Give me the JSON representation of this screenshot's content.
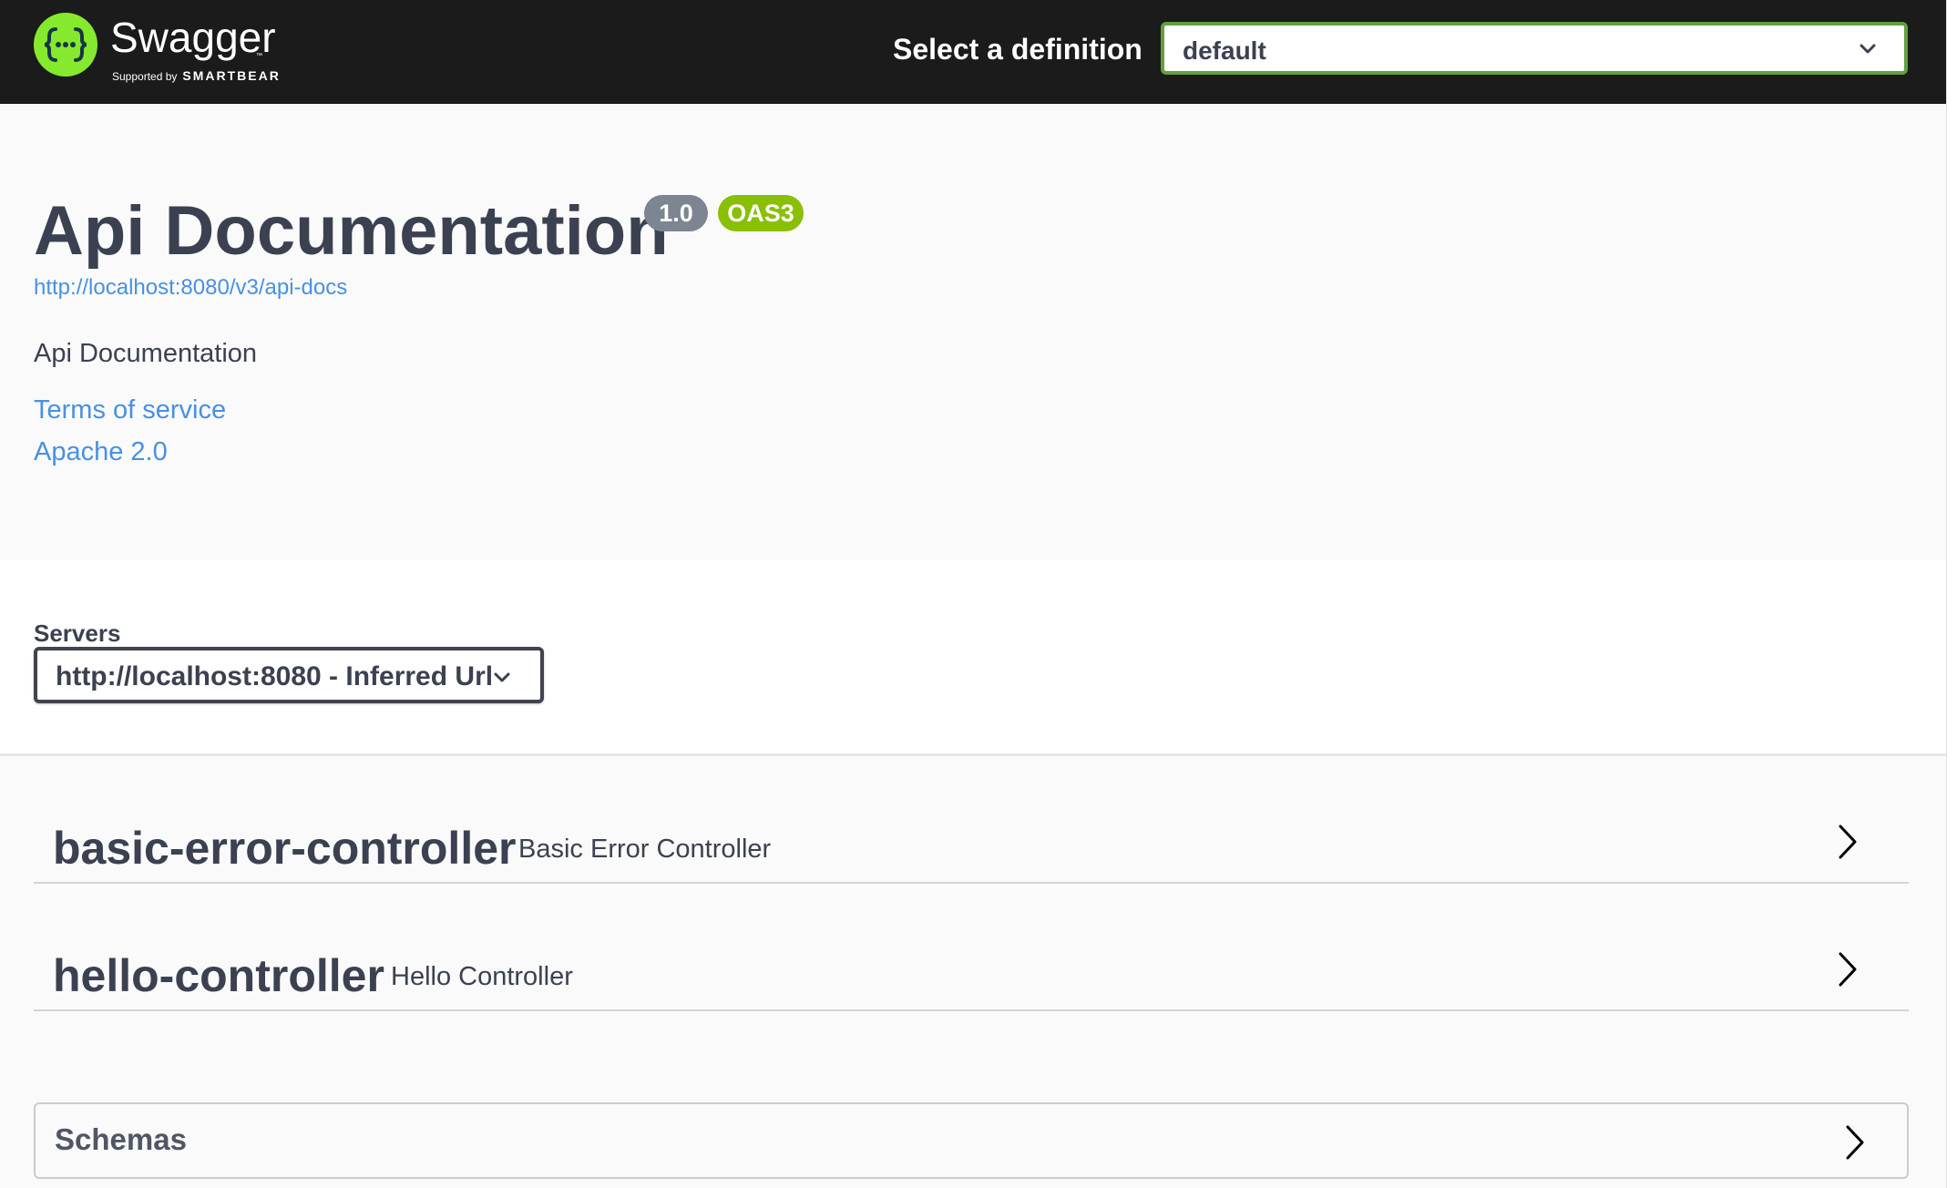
{
  "colors": {
    "topbar_bg": "#1b1b1b",
    "logo_green": "#85ea2d",
    "select_border": "#62a03f",
    "link": "#4990e2",
    "version_badge": "#7d8492",
    "oas_badge": "#89bf04",
    "text": "#3b4151"
  },
  "topbar": {
    "logo_word": "Swagger",
    "logo_tm": "™",
    "logo_supported": "Supported by",
    "logo_brand": "SMARTBEAR",
    "logo_icon": "swagger-braces-icon",
    "definition_label": "Select a definition",
    "definition_value": "default"
  },
  "info": {
    "title": "Api Documentation",
    "version": "1.0",
    "oas": "OAS3",
    "docs_url": "http://localhost:8080/v3/api-docs",
    "description": "Api Documentation",
    "terms": "Terms of service",
    "license": "Apache 2.0"
  },
  "servers": {
    "label": "Servers",
    "selected": "http://localhost:8080 - Inferred Url"
  },
  "tags": [
    {
      "name": "basic-error-controller",
      "description": "Basic Error Controller"
    },
    {
      "name": "hello-controller",
      "description": "Hello Controller"
    }
  ],
  "schemas": {
    "label": "Schemas"
  }
}
